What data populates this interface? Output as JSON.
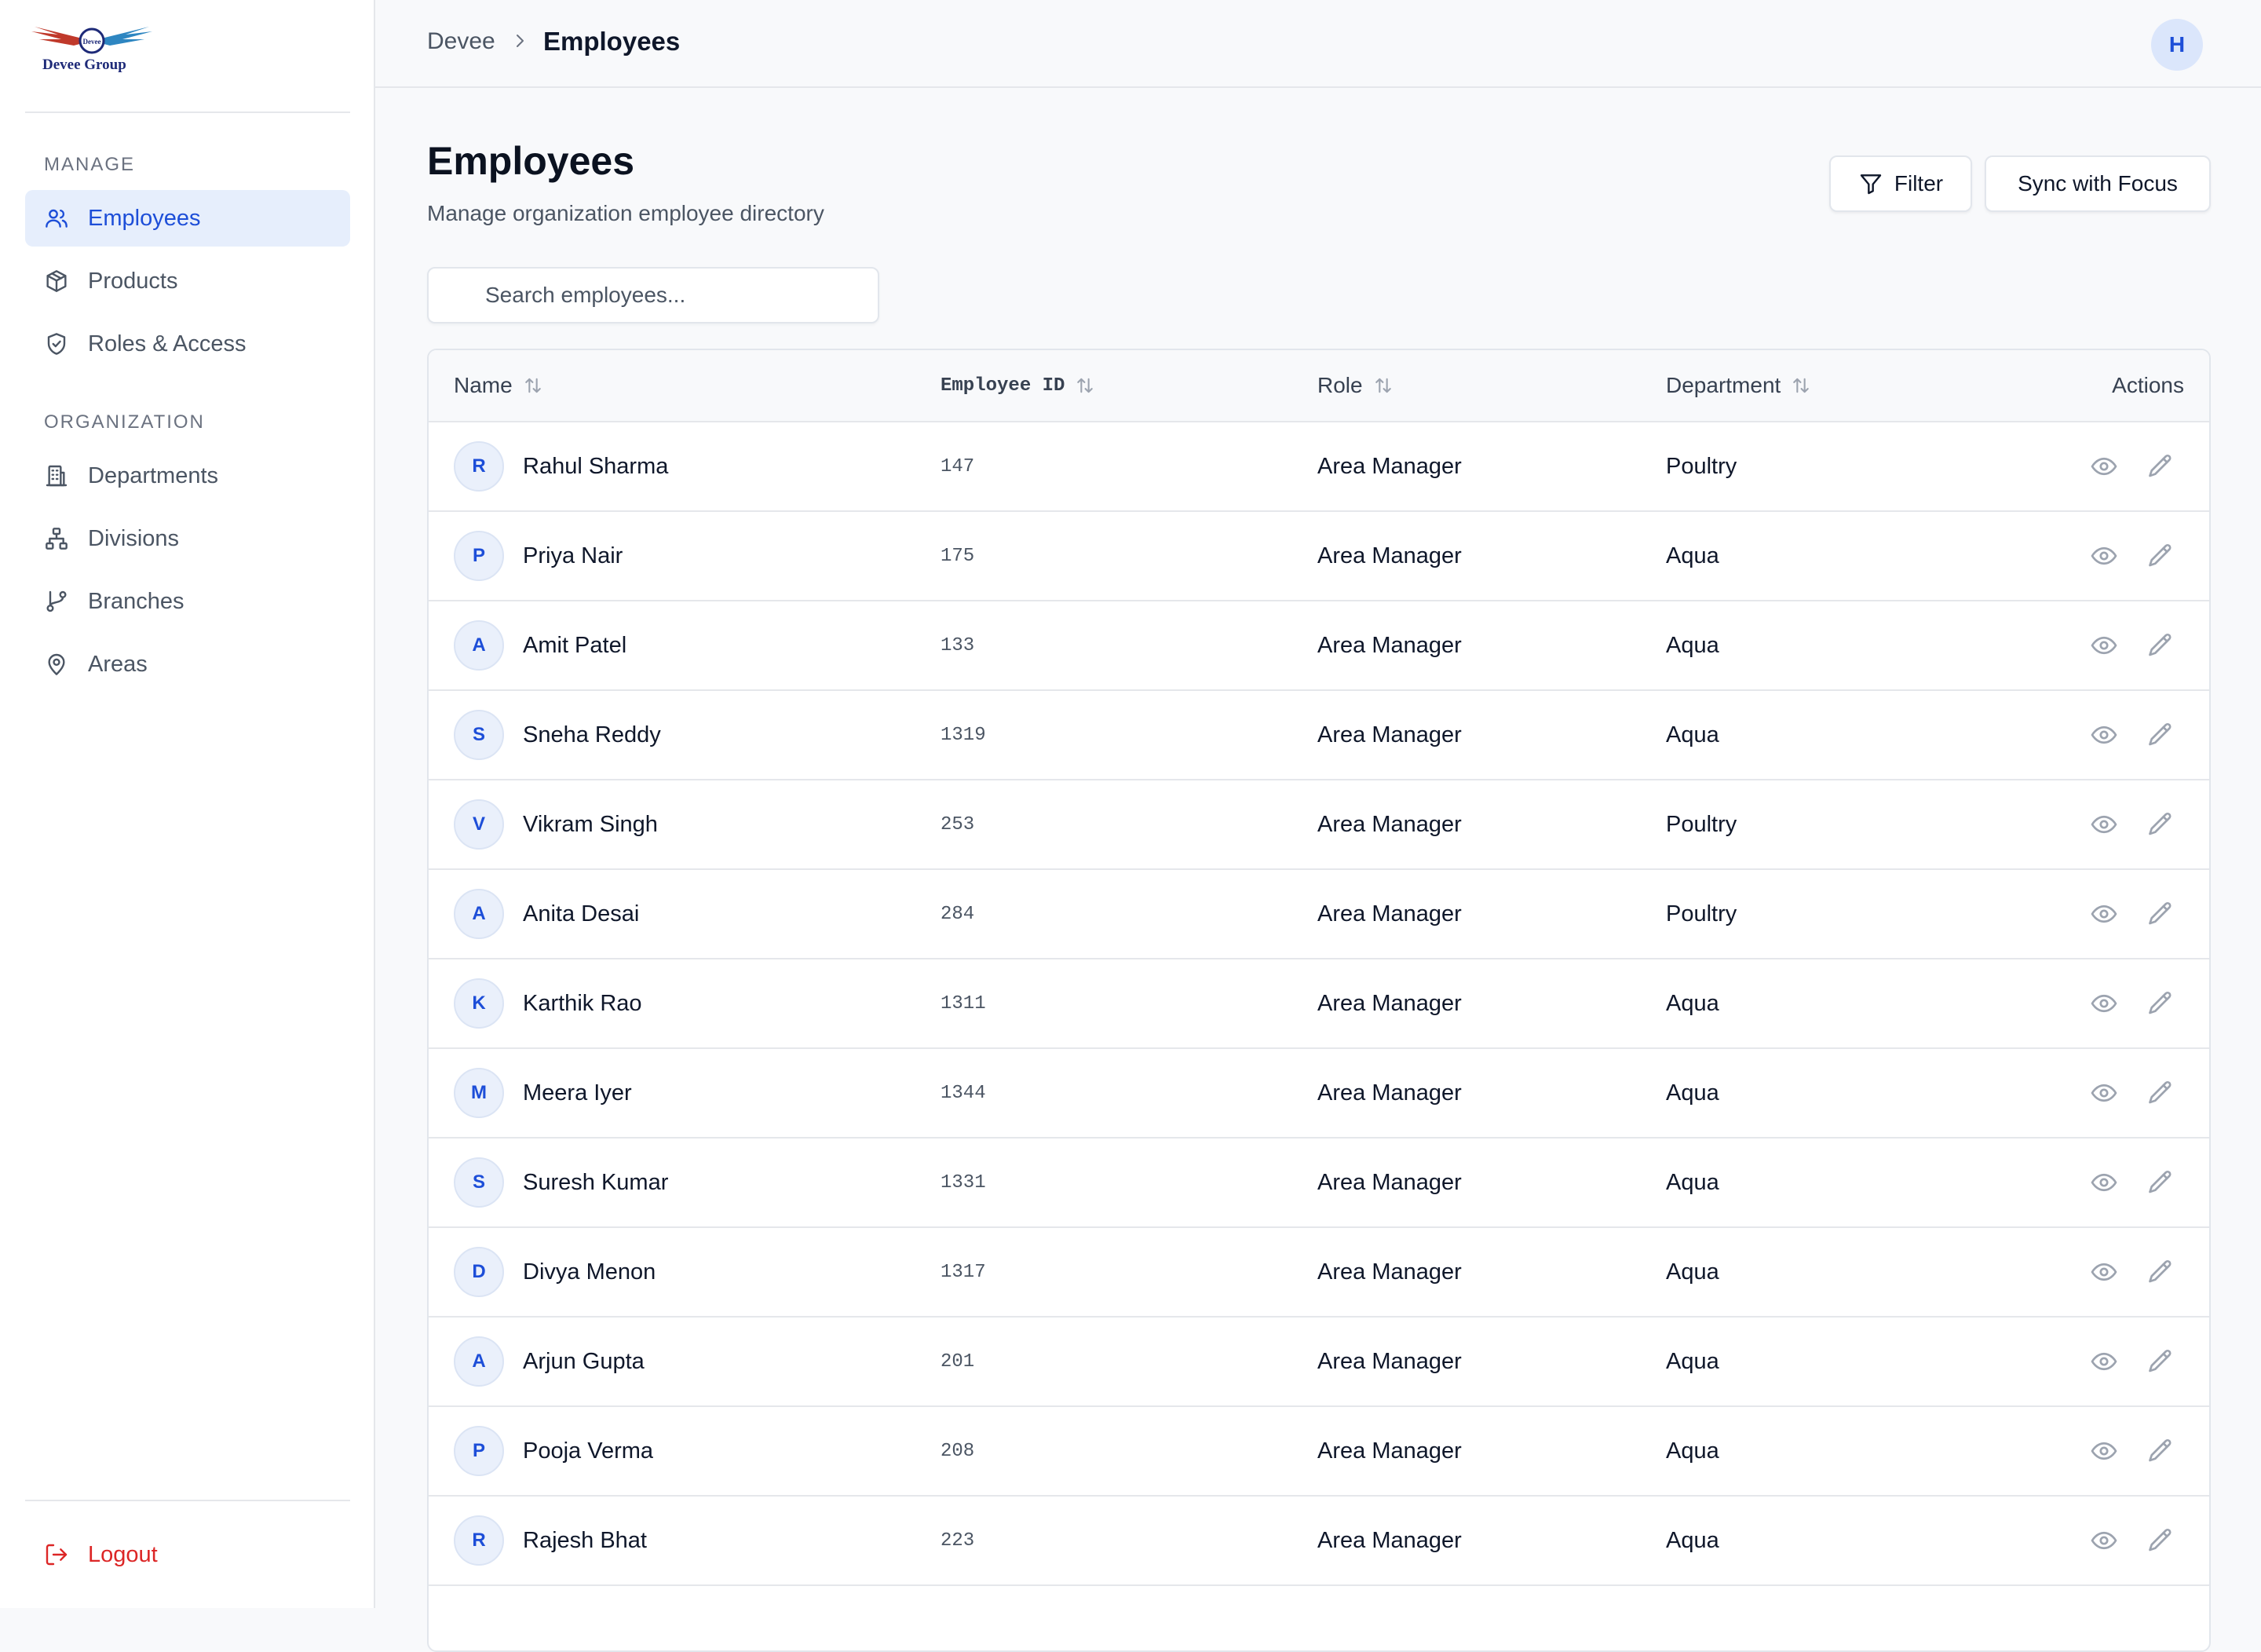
{
  "brand": {
    "name": "Devee Group",
    "badge": "Devee"
  },
  "sidebar": {
    "sections": [
      {
        "title": "MANAGE"
      },
      {
        "title": "ORGANIZATION"
      }
    ],
    "items": [
      {
        "label": "Employees",
        "icon": "users-icon",
        "active": true
      },
      {
        "label": "Products",
        "icon": "box-icon"
      },
      {
        "label": "Roles & Access",
        "icon": "shield-check-icon"
      },
      {
        "label": "Departments",
        "icon": "building-icon"
      },
      {
        "label": "Divisions",
        "icon": "network-icon"
      },
      {
        "label": "Branches",
        "icon": "git-branch-icon"
      },
      {
        "label": "Areas",
        "icon": "map-pin-icon"
      }
    ],
    "logout_label": "Logout"
  },
  "topbar": {
    "breadcrumb": [
      "Devee",
      "Employees"
    ],
    "user_initial": "H"
  },
  "page": {
    "title": "Employees",
    "subtitle": "Manage organization employee directory",
    "filter_label": "Filter",
    "sync_label": "Sync with Focus",
    "search_placeholder": "Search employees..."
  },
  "table": {
    "columns": [
      "Name",
      "Employee ID",
      "Role",
      "Department",
      "Actions"
    ],
    "rows": [
      {
        "initial": "R",
        "name": "Rahul Sharma",
        "id": "147",
        "role": "Area Manager",
        "department": "Poultry"
      },
      {
        "initial": "P",
        "name": "Priya Nair",
        "id": "175",
        "role": "Area Manager",
        "department": "Aqua"
      },
      {
        "initial": "A",
        "name": "Amit Patel",
        "id": "133",
        "role": "Area Manager",
        "department": "Aqua"
      },
      {
        "initial": "S",
        "name": "Sneha Reddy",
        "id": "1319",
        "role": "Area Manager",
        "department": "Aqua"
      },
      {
        "initial": "V",
        "name": "Vikram Singh",
        "id": "253",
        "role": "Area Manager",
        "department": "Poultry"
      },
      {
        "initial": "A",
        "name": "Anita Desai",
        "id": "284",
        "role": "Area Manager",
        "department": "Poultry"
      },
      {
        "initial": "K",
        "name": "Karthik Rao",
        "id": "1311",
        "role": "Area Manager",
        "department": "Aqua"
      },
      {
        "initial": "M",
        "name": "Meera Iyer",
        "id": "1344",
        "role": "Area Manager",
        "department": "Aqua"
      },
      {
        "initial": "S",
        "name": "Suresh Kumar",
        "id": "1331",
        "role": "Area Manager",
        "department": "Aqua"
      },
      {
        "initial": "D",
        "name": "Divya Menon",
        "id": "1317",
        "role": "Area Manager",
        "department": "Aqua"
      },
      {
        "initial": "A",
        "name": "Arjun Gupta",
        "id": "201",
        "role": "Area Manager",
        "department": "Aqua"
      },
      {
        "initial": "P",
        "name": "Pooja Verma",
        "id": "208",
        "role": "Area Manager",
        "department": "Aqua"
      },
      {
        "initial": "R",
        "name": "Rajesh Bhat",
        "id": "223",
        "role": "Area Manager",
        "department": "Aqua"
      }
    ]
  },
  "colors": {
    "accent": "#1d4ed8",
    "active_bg": "#e6eefc",
    "danger": "#dc2626"
  }
}
